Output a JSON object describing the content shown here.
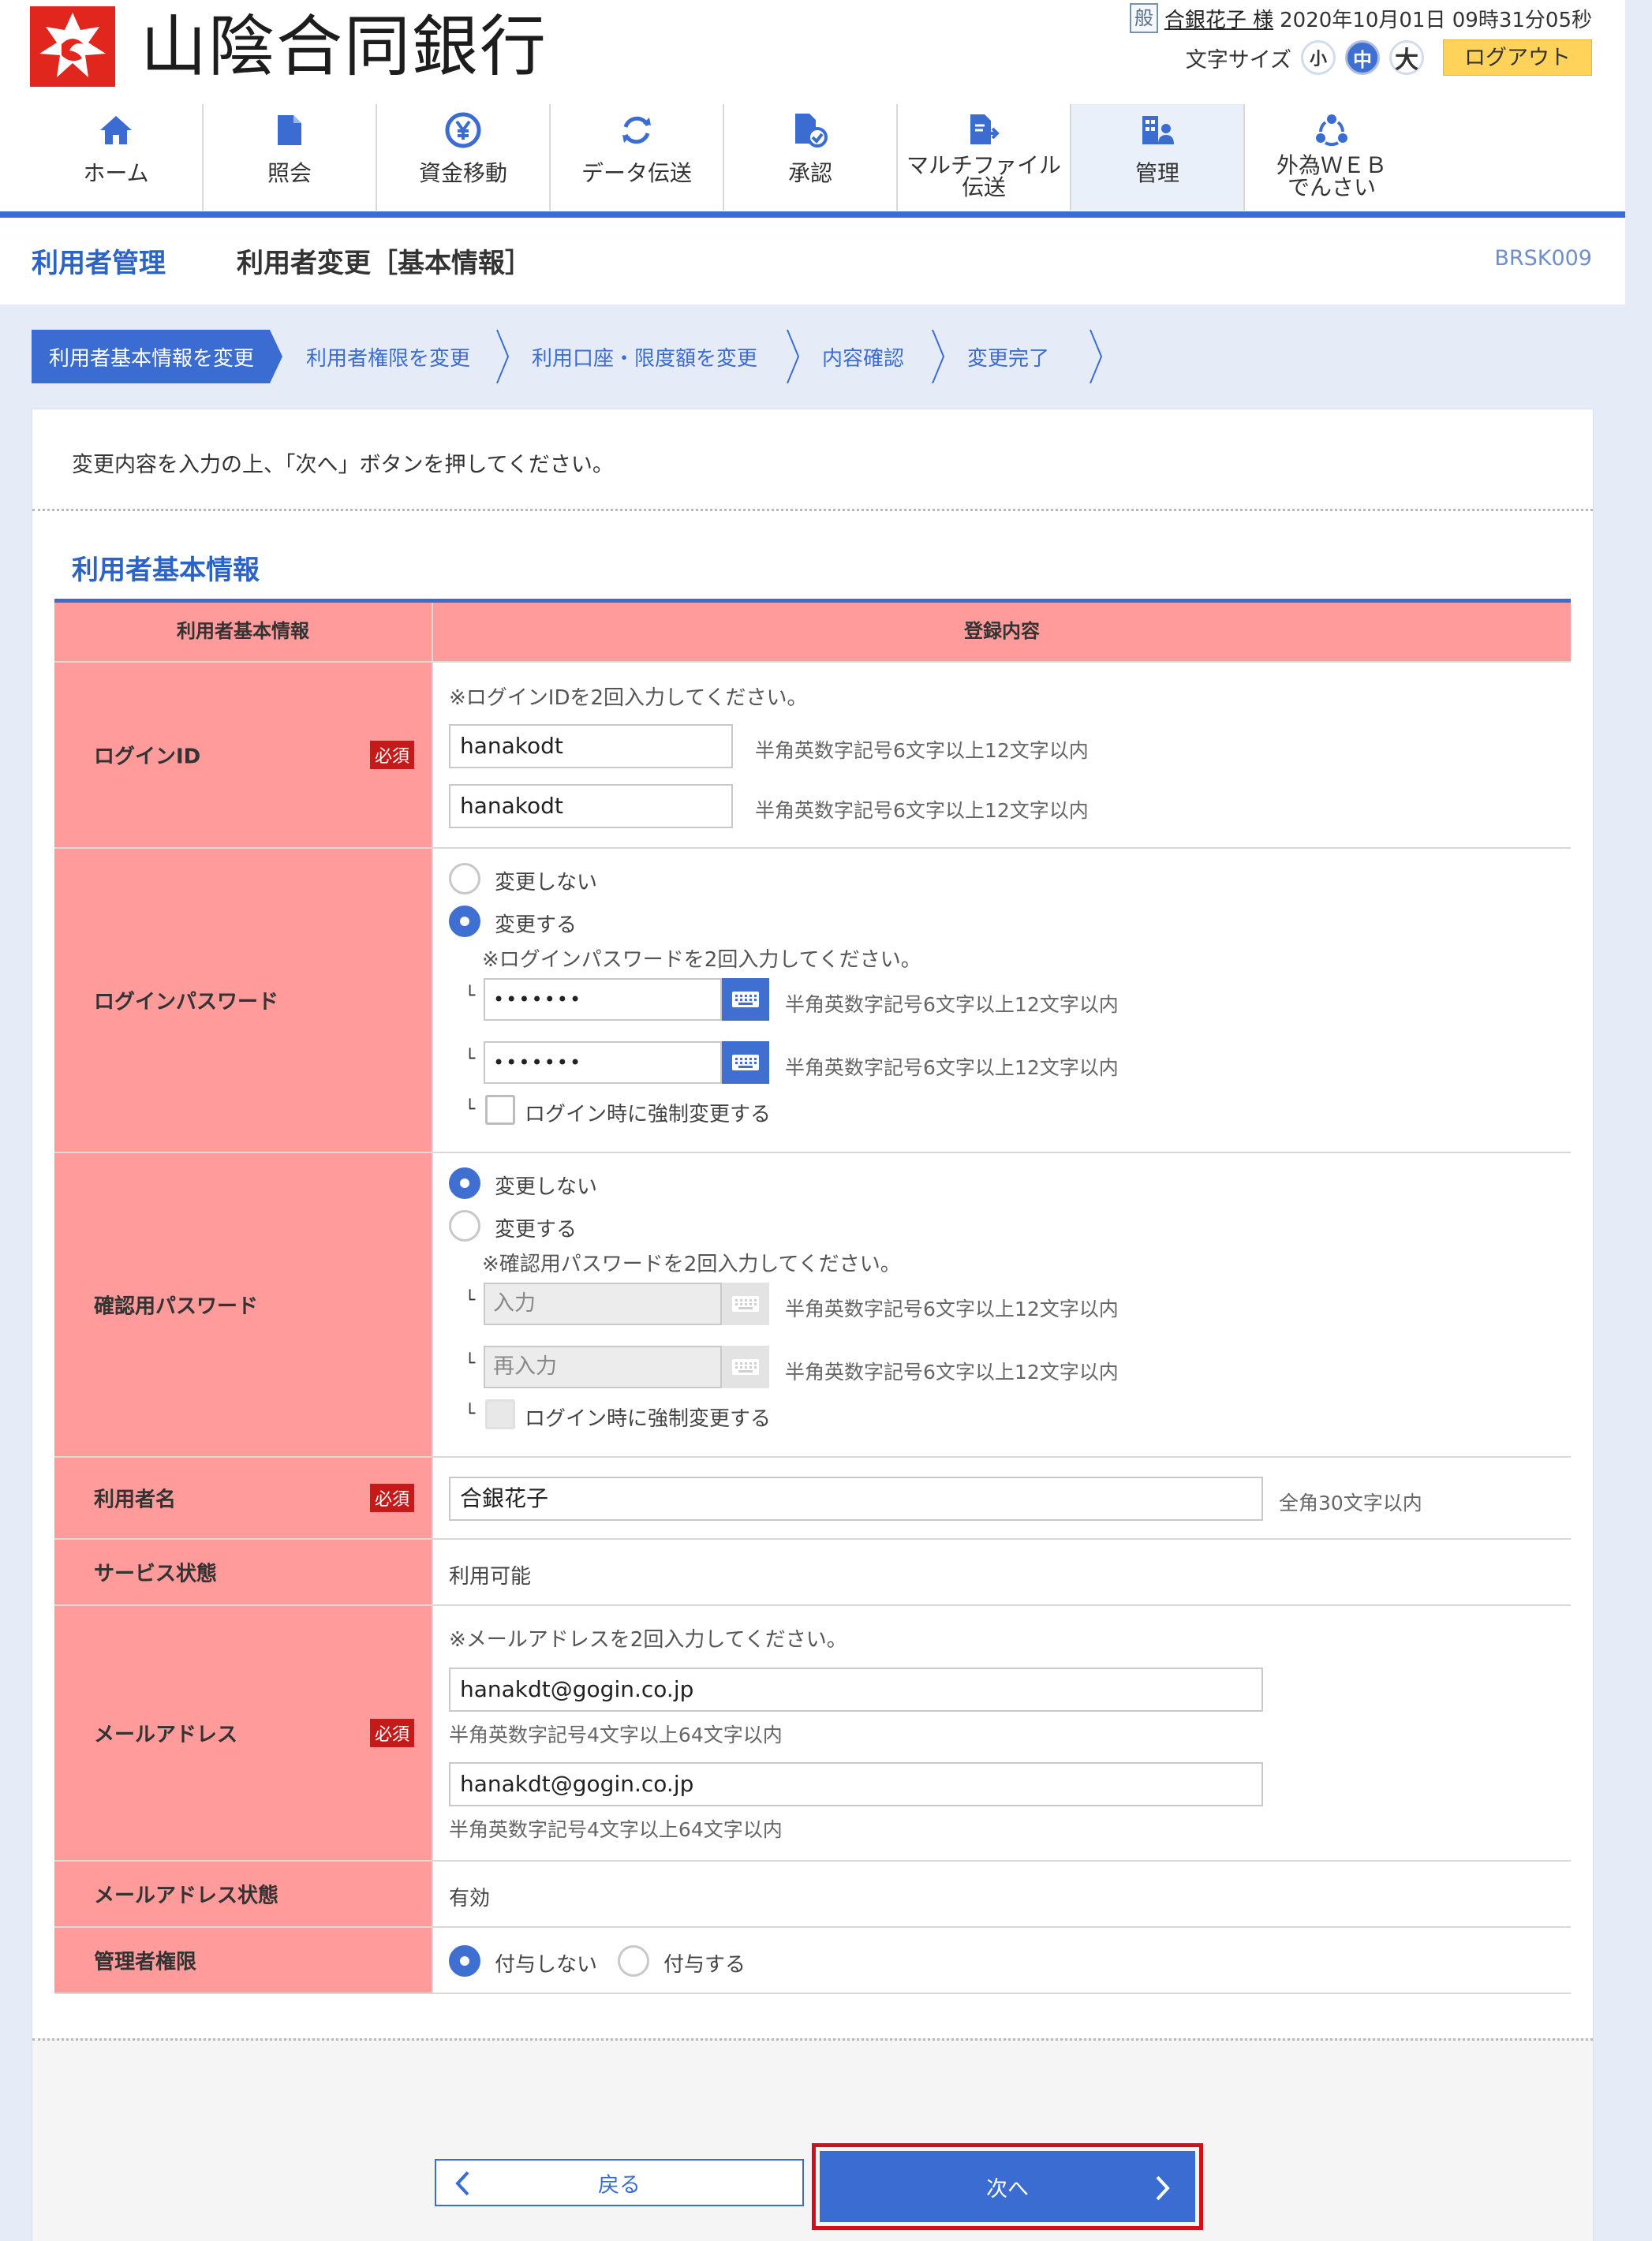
{
  "bank": {
    "name": "山陰合同銀行"
  },
  "user": {
    "badge": "般",
    "name": "合銀花子 様",
    "datetime": "2020年10月01日 09時31分05秒"
  },
  "font_size": {
    "label": "文字サイズ",
    "small": "小",
    "medium": "中",
    "large": "大",
    "selected": "中"
  },
  "logout_label": "ログアウト",
  "nav": [
    {
      "label": "ホーム",
      "icon": "home-icon"
    },
    {
      "label": "照会",
      "icon": "document-icon"
    },
    {
      "label": "資金移動",
      "icon": "yen-transfer-icon"
    },
    {
      "label": "データ伝送",
      "icon": "refresh-icon"
    },
    {
      "label": "承認",
      "icon": "approval-icon"
    },
    {
      "label": "マルチファイル\n伝送",
      "icon": "multifile-icon"
    },
    {
      "label": "管理",
      "icon": "admin-icon",
      "active": true
    },
    {
      "label": "外為ＷＥＢ\nでんさい",
      "icon": "forex-icon"
    }
  ],
  "page": {
    "category": "利用者管理",
    "title": "利用者変更［基本情報］",
    "screen_id": "BRSK009"
  },
  "steps": [
    "利用者基本情報を変更",
    "利用者権限を変更",
    "利用口座・限度額を変更",
    "内容確認",
    "変更完了"
  ],
  "intro": "変更内容を入力の上、「次へ」ボタンを押してください。",
  "section_title": "利用者基本情報",
  "table": {
    "head_label": "利用者基本情報",
    "head_value": "登録内容",
    "required": "必須",
    "login_id": {
      "label": "ログインID",
      "note": "※ログインIDを2回入力してください。",
      "value1": "hanakodt",
      "value2": "hanakodt",
      "hint": "半角英数字記号6文字以上12文字以内"
    },
    "login_pw": {
      "label": "ログインパスワード",
      "opt_nochange": "変更しない",
      "opt_change": "変更する",
      "selected": "変更する",
      "note": "※ログインパスワードを2回入力してください。",
      "value1": "•••••••",
      "value2": "•••••••",
      "hint": "半角英数字記号6文字以上12文字以内",
      "force": "ログイン時に強制変更する"
    },
    "confirm_pw": {
      "label": "確認用パスワード",
      "opt_nochange": "変更しない",
      "opt_change": "変更する",
      "selected": "変更しない",
      "note": "※確認用パスワードを2回入力してください。",
      "placeholder1": "入力",
      "placeholder2": "再入力",
      "hint": "半角英数字記号6文字以上12文字以内",
      "force": "ログイン時に強制変更する"
    },
    "user_name": {
      "label": "利用者名",
      "value": "合銀花子",
      "hint": "全角30文字以内"
    },
    "service": {
      "label": "サービス状態",
      "value": "利用可能"
    },
    "mail": {
      "label": "メールアドレス",
      "note": "※メールアドレスを2回入力してください。",
      "value1": "hanakdt@gogin.co.jp",
      "value2": "hanakdt@gogin.co.jp",
      "hint": "半角英数字記号4文字以上64文字以内"
    },
    "mail_status": {
      "label": "メールアドレス状態",
      "value": "有効"
    },
    "admin": {
      "label": "管理者権限",
      "opt_no": "付与しない",
      "opt_yes": "付与する",
      "selected": "付与しない"
    }
  },
  "buttons": {
    "back": "戻る",
    "next": "次へ"
  },
  "colors": {
    "accent": "#3a6cd2",
    "label_bg": "#ff9b9b",
    "required": "#c41a1a",
    "highlight": "#d2101b",
    "logout": "#ffd35a"
  }
}
